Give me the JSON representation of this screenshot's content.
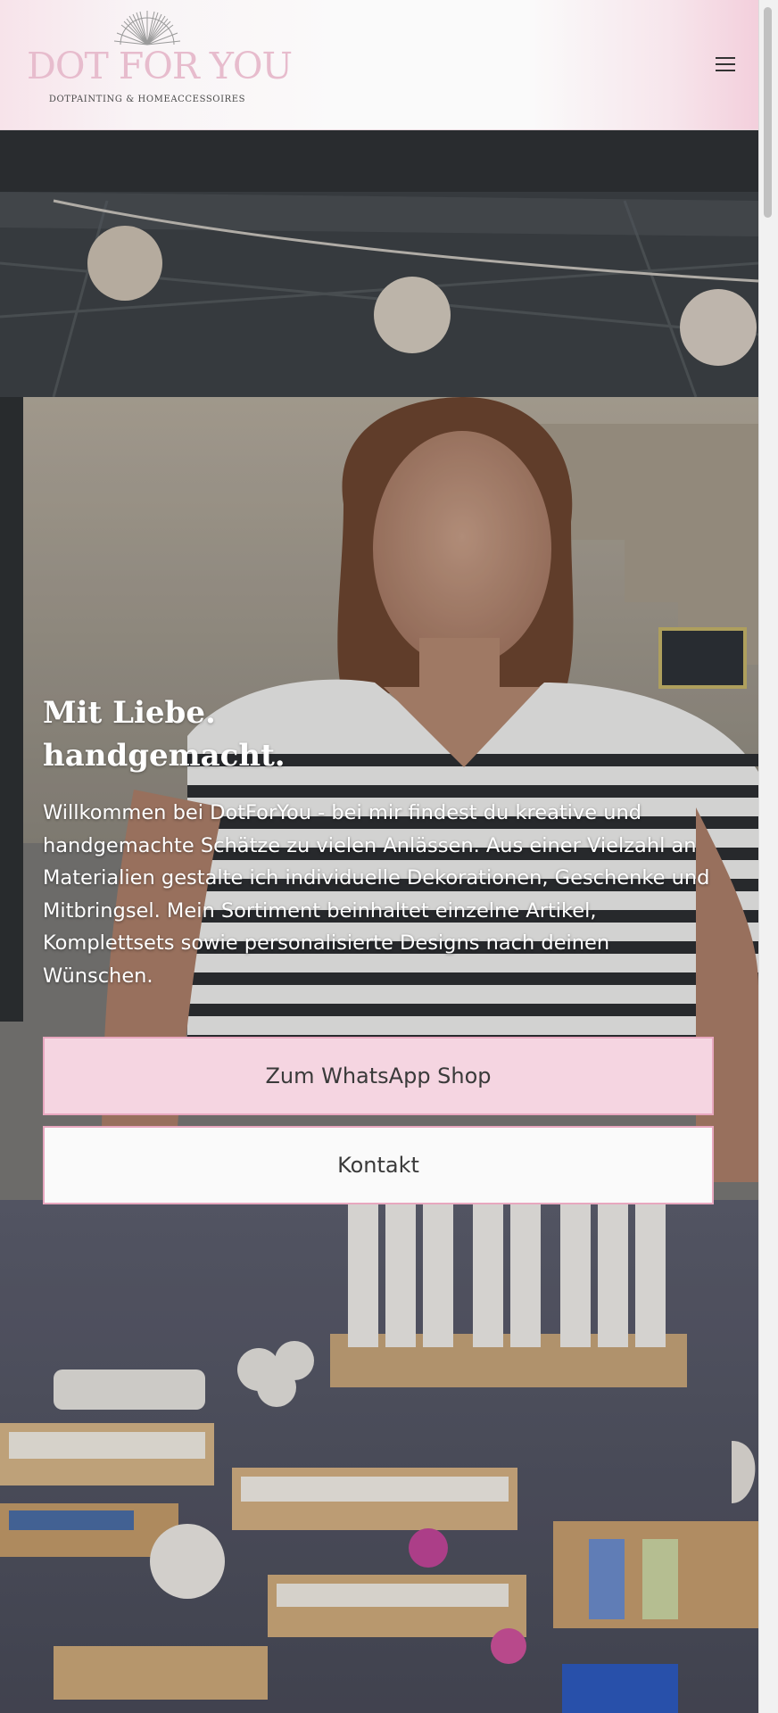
{
  "header": {
    "brand_name": "DOT FOR YOU",
    "tagline": "DOTPAINTING & HOMEACCESSOIRES",
    "menu_icon": "hamburger-menu-icon"
  },
  "hero": {
    "title_line1": "Mit Liebe.",
    "title_line2": "handgemacht.",
    "text": "Willkommen bei DotForYou - bei mir findest du kreative und handgemachte Schätze zu vielen Anlässen. Aus einer Vielzahl an Materialien gestalte ich individuelle Dekorationen, Geschenke und Mitbringsel. Mein Sortiment beinhaltet einzelne Artikel, Komplettsets sowie personalisierte Designs nach deinen Wünschen.",
    "button_whatsapp": "Zum WhatsApp Shop",
    "button_kontakt": "Kontakt"
  },
  "colors": {
    "brand_pink": "#e7bccd",
    "button_pink": "#f5d5e1",
    "button_border": "#e8a7bf"
  }
}
